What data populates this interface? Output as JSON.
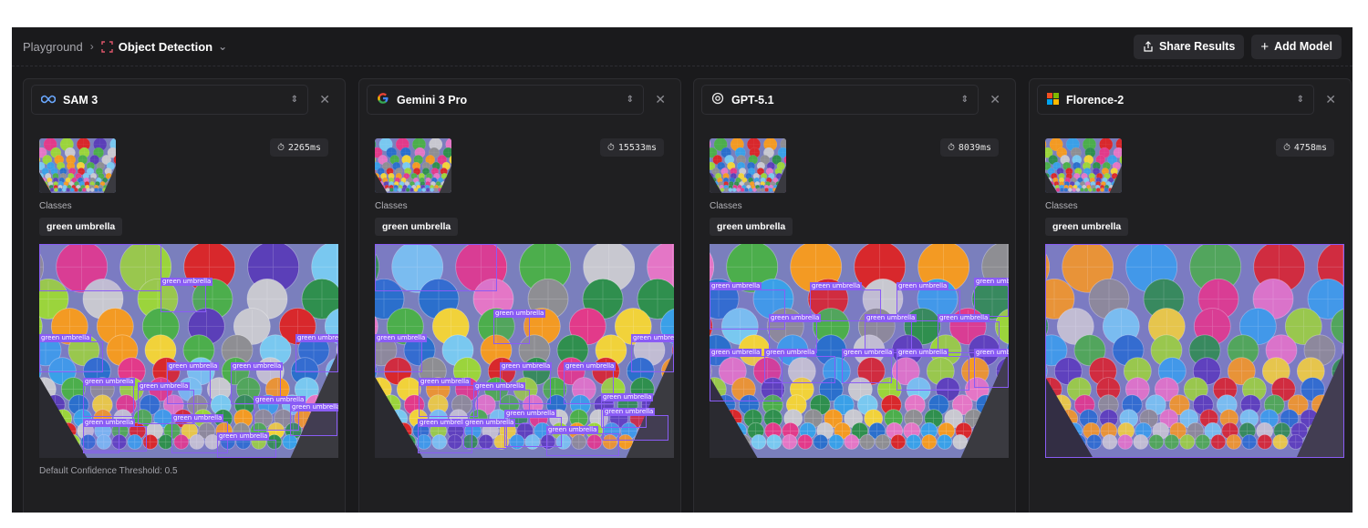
{
  "breadcrumb": {
    "root": "Playground",
    "current": "Object Detection"
  },
  "actions": {
    "share": "Share Results",
    "add_model": "Add Model"
  },
  "panels": [
    {
      "model": "SAM 3",
      "logo": "infinity-icon",
      "time": "2265ms",
      "classes_label": "Classes",
      "class_chip": "green umbrella",
      "footer": "Default Confidence Threshold: 0.5",
      "boxes": [
        {
          "label": "green umbrella"
        },
        {
          "label": "green umbrella"
        },
        {
          "label": "green umbrella"
        },
        {
          "label": "green umbrella"
        },
        {
          "label": "green umbrella"
        },
        {
          "label": "green umbrella"
        },
        {
          "label": "green umbrella"
        },
        {
          "label": "green umbrella"
        },
        {
          "label": "green umbrella"
        },
        {
          "label": "green umbrella"
        },
        {
          "label": "green umbrella"
        },
        {
          "label": "green umbrella"
        },
        {
          "label": "green umbrella"
        },
        {
          "label": "green umbrella"
        }
      ]
    },
    {
      "model": "Gemini 3 Pro",
      "logo": "google-g-icon",
      "time": "15533ms",
      "classes_label": "Classes",
      "class_chip": "green umbrella",
      "footer": "",
      "boxes": [
        {
          "label": "green umbrella"
        },
        {
          "label": "green umbrella"
        },
        {
          "label": "green umbrella"
        },
        {
          "label": "green umbrella"
        },
        {
          "label": "green umbrella"
        },
        {
          "label": "green umbrella"
        },
        {
          "label": "green umbrella"
        },
        {
          "label": "green umbrella"
        },
        {
          "label": "green umbrella"
        },
        {
          "label": "green umbrella"
        },
        {
          "label": "green umbrella"
        },
        {
          "label": "green umbrella"
        },
        {
          "label": "green umbrella"
        },
        {
          "label": "green umbrella"
        }
      ]
    },
    {
      "model": "GPT-5.1",
      "logo": "openai-icon",
      "time": "8039ms",
      "classes_label": "Classes",
      "class_chip": "green umbrella",
      "footer": "",
      "boxes": [
        {
          "label": "green umbrella"
        },
        {
          "label": "green umbrella"
        },
        {
          "label": "green umbrella"
        },
        {
          "label": "green umbrella"
        },
        {
          "label": "green umbrella"
        },
        {
          "label": "green umbrella"
        },
        {
          "label": "green umbrella"
        },
        {
          "label": "green umbrella"
        },
        {
          "label": "green umbrella"
        },
        {
          "label": "green umbrella"
        },
        {
          "label": "green umbrella"
        },
        {
          "label": "green umbrella"
        }
      ]
    },
    {
      "model": "Florence-2",
      "logo": "microsoft-icon",
      "time": "4758ms",
      "classes_label": "Classes",
      "class_chip": "green umbrella",
      "footer": "",
      "boxes": [
        {
          "label": ""
        }
      ]
    }
  ],
  "colors": {
    "app_bg": "#1a1a1c",
    "panel_bg": "#1f1f21",
    "box_accent": "#8a5cf5"
  }
}
